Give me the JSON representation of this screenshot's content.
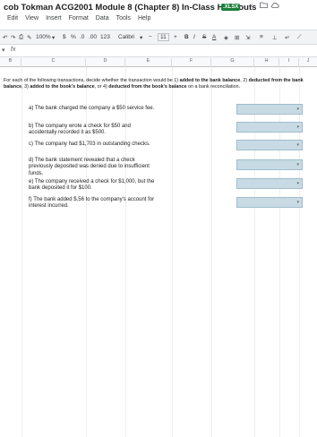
{
  "title": {
    "text": "cob Tokman ACG2001 Module 8 (Chapter 8) In-Class Handouts",
    "badge": ".XLSX"
  },
  "menu": [
    "Edit",
    "View",
    "Insert",
    "Format",
    "Data",
    "Tools",
    "Help"
  ],
  "toolbar": {
    "zoom": "100%",
    "currency": "$",
    "percent": "%",
    "decimal_less": ".0",
    "decimal_more": ".00",
    "number_format": "123",
    "font": "Calibri",
    "font_size": "11",
    "minus": "−",
    "plus": "+",
    "bold": "B",
    "italic": "I",
    "strike": "S",
    "text_color": "A"
  },
  "formula_bar": {
    "fx": "fx"
  },
  "columns": [
    "B",
    "C",
    "D",
    "E",
    "F",
    "G",
    "H",
    "I",
    "J"
  ],
  "instructions": {
    "text_1": "For each of the following transactions, decide whether the transaction would be 1) ",
    "added": "added to the bank balance",
    "text_2": ", 2) ",
    "deducted": "deducted from the bank balance",
    "text_3": ", 3)",
    "added_book": "added to the book's balance",
    "text_4": ", or 4) ",
    "deducted_book": "deducted from the book's balance",
    "text_5": " on a bank reconciliation."
  },
  "questions": [
    {
      "label": "a) The bank charged the company a $50 service fee."
    },
    {
      "label": "b) The company wrote a check for $50 and accidentally recorded it as $500."
    },
    {
      "label": "c) The company had $1,703 in outstanding checks."
    },
    {
      "label": "d) The bank statement revealed that a check previously deposited was denied due to insufficient funds."
    },
    {
      "label": "e) The company received a check for $1,000, but the bank deposited it for $100."
    },
    {
      "label": "f) The bank added $.56 to the company's account for interest incurred."
    }
  ],
  "colors": {
    "answer_fill": "#c8dbe5",
    "xlsx_badge": "#188038"
  }
}
